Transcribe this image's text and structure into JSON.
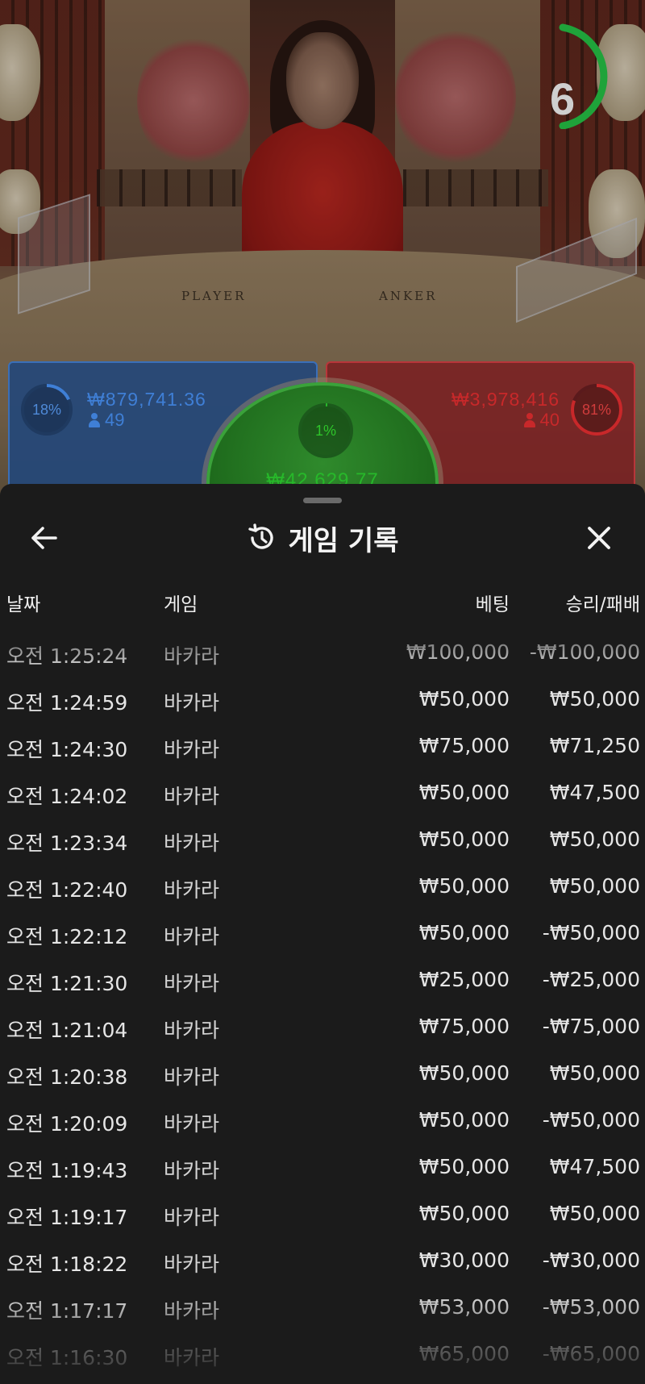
{
  "live_table": {
    "countdown": "6",
    "table_labels": {
      "player": "PLAYER",
      "banker": "ANKER"
    },
    "player_spot": {
      "percent": "18%",
      "percent_value": 0.18,
      "amount": "₩879,741.36",
      "players": "49"
    },
    "tie_spot": {
      "percent": "1%",
      "percent_value": 0.01,
      "amount": "₩42,629.77"
    },
    "banker_spot": {
      "percent": "81%",
      "percent_value": 0.81,
      "amount": "₩3,978,416",
      "players": "40"
    }
  },
  "history_sheet": {
    "title": "게임 기록",
    "icons": {
      "back": "arrow-left-icon",
      "title": "history-icon",
      "close": "close-icon"
    },
    "columns": {
      "date": "날짜",
      "game": "게임",
      "bet": "베팅",
      "win_loss": "승리/패배"
    },
    "rows": [
      {
        "time": "오전 1:25:24",
        "game": "바카라",
        "bet": "₩100,000",
        "result": "-₩100,000"
      },
      {
        "time": "오전 1:24:59",
        "game": "바카라",
        "bet": "₩50,000",
        "result": "₩50,000"
      },
      {
        "time": "오전 1:24:30",
        "game": "바카라",
        "bet": "₩75,000",
        "result": "₩71,250"
      },
      {
        "time": "오전 1:24:02",
        "game": "바카라",
        "bet": "₩50,000",
        "result": "₩47,500"
      },
      {
        "time": "오전 1:23:34",
        "game": "바카라",
        "bet": "₩50,000",
        "result": "₩50,000"
      },
      {
        "time": "오전 1:22:40",
        "game": "바카라",
        "bet": "₩50,000",
        "result": "₩50,000"
      },
      {
        "time": "오전 1:22:12",
        "game": "바카라",
        "bet": "₩50,000",
        "result": "-₩50,000"
      },
      {
        "time": "오전 1:21:30",
        "game": "바카라",
        "bet": "₩25,000",
        "result": "-₩25,000"
      },
      {
        "time": "오전 1:21:04",
        "game": "바카라",
        "bet": "₩75,000",
        "result": "-₩75,000"
      },
      {
        "time": "오전 1:20:38",
        "game": "바카라",
        "bet": "₩50,000",
        "result": "₩50,000"
      },
      {
        "time": "오전 1:20:09",
        "game": "바카라",
        "bet": "₩50,000",
        "result": "-₩50,000"
      },
      {
        "time": "오전 1:19:43",
        "game": "바카라",
        "bet": "₩50,000",
        "result": "₩47,500"
      },
      {
        "time": "오전 1:19:17",
        "game": "바카라",
        "bet": "₩50,000",
        "result": "₩50,000"
      },
      {
        "time": "오전 1:18:22",
        "game": "바카라",
        "bet": "₩30,000",
        "result": "-₩30,000"
      },
      {
        "time": "오전 1:17:17",
        "game": "바카라",
        "bet": "₩53,000",
        "result": "-₩53,000"
      },
      {
        "time": "오전 1:16:30",
        "game": "바카라",
        "bet": "₩65,000",
        "result": "-₩65,000"
      }
    ]
  },
  "colors": {
    "player": "#3f7fd6",
    "banker": "#c8282a",
    "tie": "#27b82a",
    "countdown_ring": "#1fa33a",
    "sheet_bg": "#1b1b1b"
  }
}
